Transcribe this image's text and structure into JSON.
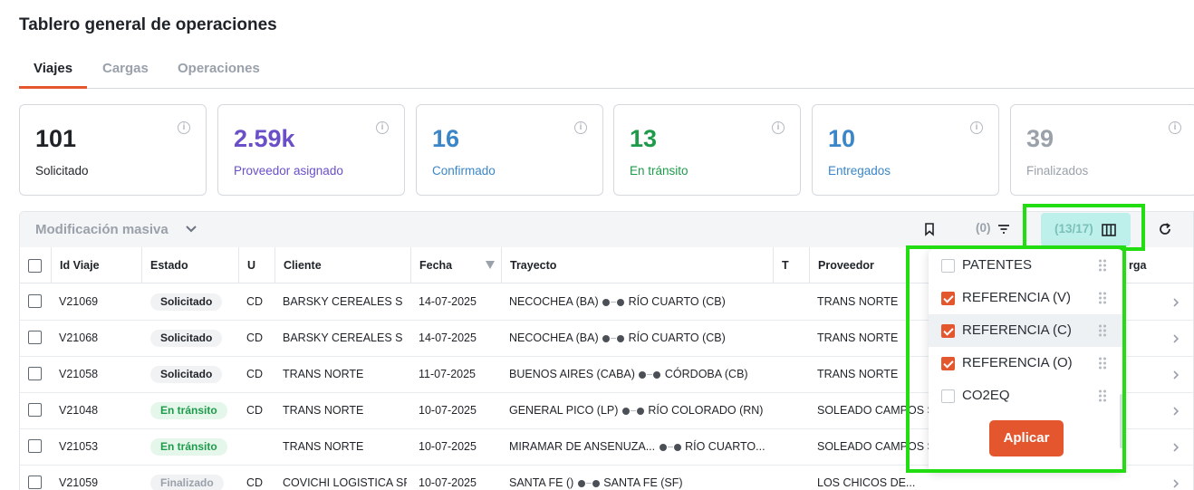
{
  "page_title": "Tablero general de operaciones",
  "tabs": [
    {
      "label": "Viajes",
      "active": true
    },
    {
      "label": "Cargas",
      "active": false
    },
    {
      "label": "Operaciones",
      "active": false
    }
  ],
  "kpis": [
    {
      "value": "101",
      "label": "Solicitado",
      "color": "#1f2328"
    },
    {
      "value": "2.59k",
      "label": "Proveedor asignado",
      "color": "#6a4fc8"
    },
    {
      "value": "16",
      "label": "Confirmado",
      "color": "#3a86c8"
    },
    {
      "value": "13",
      "label": "En tránsito",
      "color": "#1e9b4a"
    },
    {
      "value": "10",
      "label": "Entregados",
      "color": "#3a86c8"
    },
    {
      "value": "39",
      "label": "Finalizados",
      "color": "#9aa1aa"
    }
  ],
  "toolbar": {
    "bulk_label": "Modificación masiva",
    "filter_count": "(0)",
    "columns_count": "(13/17)"
  },
  "table": {
    "headers": [
      "Id Viaje",
      "Estado",
      "U",
      "Cliente",
      "Fecha",
      "Trayecto",
      "T",
      "Proveedor",
      "Carga"
    ],
    "header_carga_partial": "rga",
    "rows": [
      {
        "id": "V21069",
        "estado": "Solicitado",
        "estado_type": "sol",
        "u": "CD",
        "cliente": "BARSKY CEREALES S R...",
        "fecha": "14-07-2025",
        "origen": "NECOCHEA (BA)",
        "destino": "RÍO CUARTO (CB)",
        "proveedor": "TRANS NORTE"
      },
      {
        "id": "V21068",
        "estado": "Solicitado",
        "estado_type": "sol",
        "u": "CD",
        "cliente": "BARSKY CEREALES S R...",
        "fecha": "14-07-2025",
        "origen": "NECOCHEA (BA)",
        "destino": "RÍO CUARTO (CB)",
        "proveedor": "TRANS NORTE"
      },
      {
        "id": "V21058",
        "estado": "Solicitado",
        "estado_type": "sol",
        "u": "CD",
        "cliente": "TRANS NORTE",
        "fecha": "11-07-2025",
        "origen": "BUENOS AIRES (CABA)",
        "destino": "CÓRDOBA (CB)",
        "proveedor": "TRANS NORTE"
      },
      {
        "id": "V21048",
        "estado": "En tránsito",
        "estado_type": "tra",
        "u": "CD",
        "cliente": "TRANS NORTE",
        "fecha": "10-07-2025",
        "origen": "GENERAL PICO (LP)",
        "destino": "RÍO COLORADO (RN)",
        "proveedor": "SOLEADO CAMPOS SRL"
      },
      {
        "id": "V21053",
        "estado": "En tránsito",
        "estado_type": "tra",
        "u": "",
        "cliente": "TRANS NORTE",
        "fecha": "10-07-2025",
        "origen": "MIRAMAR DE ANSENUZA...",
        "destino": "RÍO CUARTO...",
        "proveedor": "SOLEADO CAMPOS SRL"
      },
      {
        "id": "V21059",
        "estado": "Finalizado",
        "estado_type": "fin",
        "u": "CD",
        "cliente": "COVICHI LOGISTICA SRL",
        "fecha": "10-07-2025",
        "origen": "SANTA FE ()",
        "destino": "SANTA FE (SF)",
        "proveedor": "LOS CHICOS DE..."
      }
    ]
  },
  "column_menu": {
    "items": [
      {
        "label": "PATENTES",
        "checked": false
      },
      {
        "label": "REFERENCIA (V)",
        "checked": true
      },
      {
        "label": "REFERENCIA (C)",
        "checked": true
      },
      {
        "label": "REFERENCIA (O)",
        "checked": true
      },
      {
        "label": "CO2EQ",
        "checked": false
      }
    ],
    "apply_label": "Aplicar"
  },
  "colors": {
    "accent": "#e4572e",
    "highlight": "#22dd11",
    "columns_button_bg": "#bdf0ea"
  }
}
